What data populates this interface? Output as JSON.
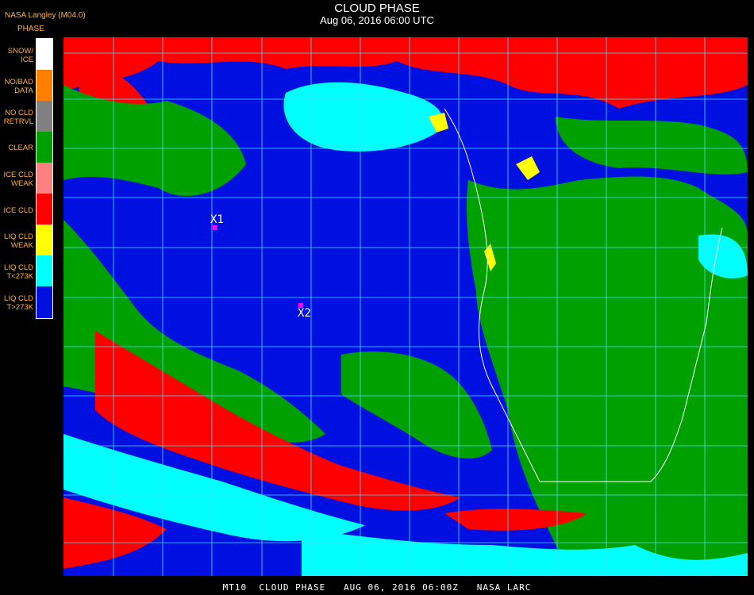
{
  "header": {
    "org": "NASA Langley (M04.0)",
    "phase": "PHASE",
    "title": "CLOUD PHASE",
    "subtitle": "Aug 06, 2016 06:00 UTC"
  },
  "legend": {
    "items": [
      {
        "label": "SNOW/\nICE",
        "color": "#ffffff"
      },
      {
        "label": "NO/BAD\nDATA",
        "color": "#ff8000"
      },
      {
        "label": "NO CLD\nRETRVL",
        "color": "#808080"
      },
      {
        "label": "CLEAR",
        "color": "#00a000"
      },
      {
        "label": "ICE CLD\nWEAK",
        "color": "#ff8080"
      },
      {
        "label": "ICE CLD",
        "color": "#ff0000"
      },
      {
        "label": "LIQ CLD\nWEAK",
        "color": "#ffff00"
      },
      {
        "label": "LIQ CLD\nT<273K",
        "color": "#00ffff"
      },
      {
        "label": "LIQ CLD\nT>273K",
        "color": "#0010e0"
      }
    ]
  },
  "markers": [
    {
      "label": "X1"
    },
    {
      "label": "X2"
    }
  ],
  "footer": {
    "text": "MT10  CLOUD PHASE   AUG 06, 2016 06:00Z   NASA LARC"
  },
  "colors": {
    "ocean_liquid": "#0010e0",
    "clear": "#00a000",
    "ice": "#ff0000",
    "liquid_cold": "#00ffff",
    "grid": "#40e0ff",
    "coast": "#ffffff",
    "marker": "#ff00ff"
  }
}
